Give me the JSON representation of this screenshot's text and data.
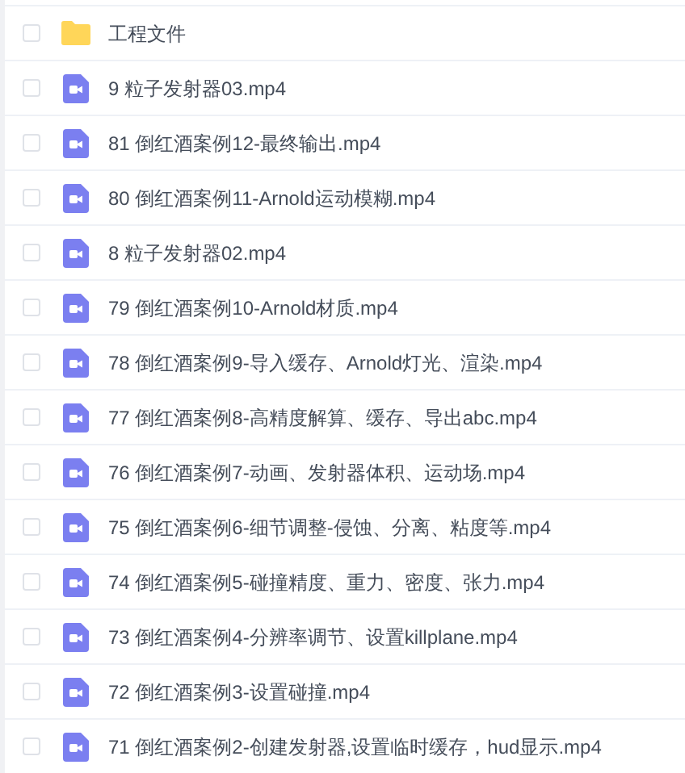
{
  "files": [
    {
      "kind": "folder",
      "name": "工程文件",
      "checked": false
    },
    {
      "kind": "video",
      "name": "9 粒子发射器03.mp4",
      "checked": false
    },
    {
      "kind": "video",
      "name": "81 倒红酒案例12-最终输出.mp4",
      "checked": false
    },
    {
      "kind": "video",
      "name": "80 倒红酒案例11-Arnold运动模糊.mp4",
      "checked": false
    },
    {
      "kind": "video",
      "name": "8 粒子发射器02.mp4",
      "checked": false
    },
    {
      "kind": "video",
      "name": "79 倒红酒案例10-Arnold材质.mp4",
      "checked": false
    },
    {
      "kind": "video",
      "name": "78 倒红酒案例9-导入缓存、Arnold灯光、渲染.mp4",
      "checked": false
    },
    {
      "kind": "video",
      "name": "77 倒红酒案例8-高精度解算、缓存、导出abc.mp4",
      "checked": false
    },
    {
      "kind": "video",
      "name": "76 倒红酒案例7-动画、发射器体积、运动场.mp4",
      "checked": false
    },
    {
      "kind": "video",
      "name": "75 倒红酒案例6-细节调整-侵蚀、分离、粘度等.mp4",
      "checked": false
    },
    {
      "kind": "video",
      "name": "74 倒红酒案例5-碰撞精度、重力、密度、张力.mp4",
      "checked": false
    },
    {
      "kind": "video",
      "name": "73 倒红酒案例4-分辨率调节、设置killplane.mp4",
      "checked": false
    },
    {
      "kind": "video",
      "name": "72 倒红酒案例3-设置碰撞.mp4",
      "checked": false
    },
    {
      "kind": "video",
      "name": "71 倒红酒案例2-创建发射器,设置临时缓存，hud显示.mp4",
      "checked": false
    }
  ]
}
